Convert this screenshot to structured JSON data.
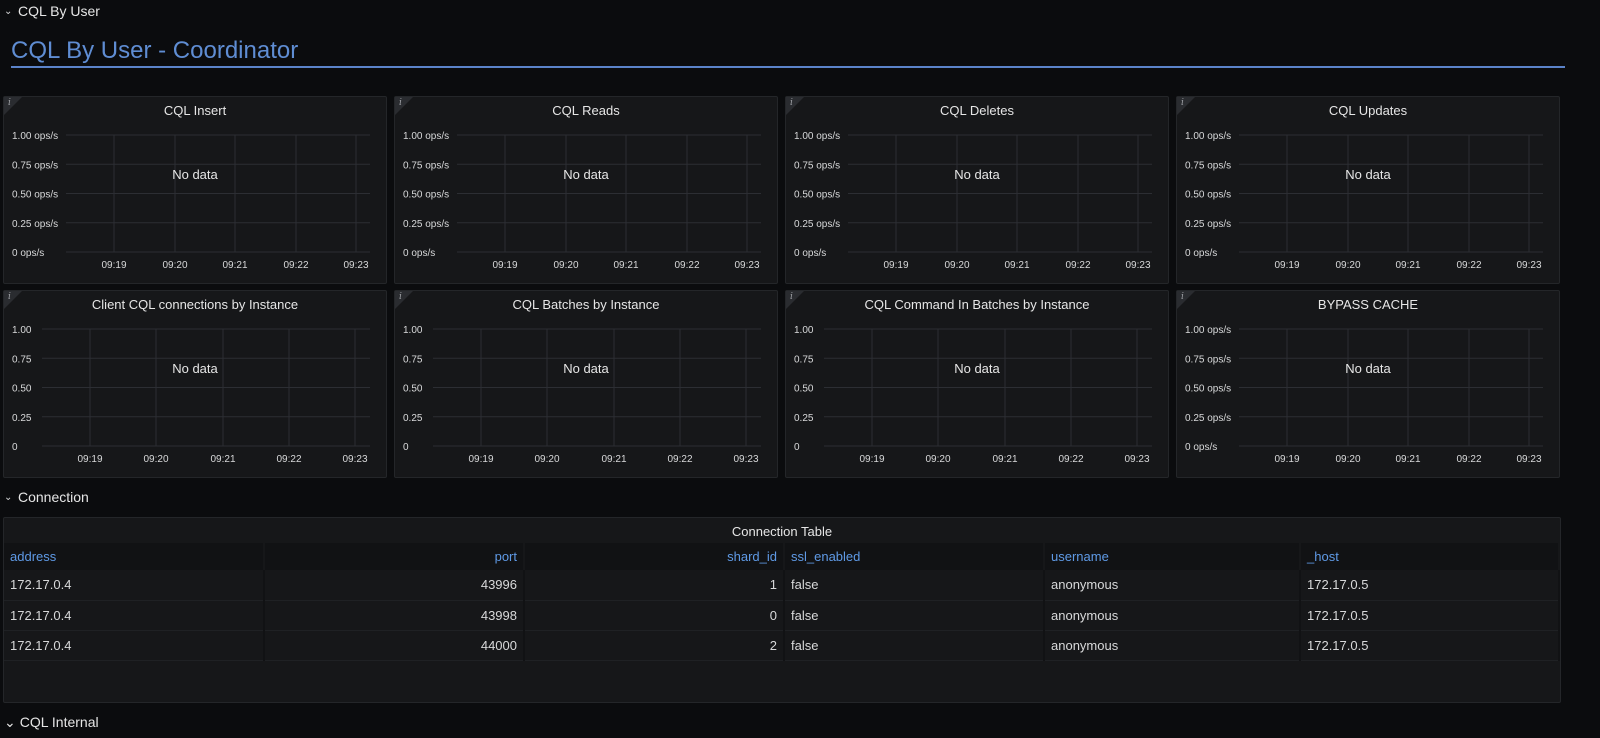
{
  "rows": {
    "cql_by_user": "CQL By User",
    "connection": "Connection",
    "cql_internal": "CQL Internal"
  },
  "section_title": "CQL By User - Coordinator",
  "info_icon": "i",
  "no_data": "No data",
  "x_ticks": [
    "09:19",
    "09:20",
    "09:21",
    "09:22",
    "09:23"
  ],
  "panels": [
    {
      "title": "CQL Insert",
      "y_ticks": [
        "1.00 ops/s",
        "0.75 ops/s",
        "0.50 ops/s",
        "0.25 ops/s",
        "0 ops/s"
      ]
    },
    {
      "title": "CQL Reads",
      "y_ticks": [
        "1.00 ops/s",
        "0.75 ops/s",
        "0.50 ops/s",
        "0.25 ops/s",
        "0 ops/s"
      ]
    },
    {
      "title": "CQL Deletes",
      "y_ticks": [
        "1.00 ops/s",
        "0.75 ops/s",
        "0.50 ops/s",
        "0.25 ops/s",
        "0 ops/s"
      ]
    },
    {
      "title": "CQL Updates",
      "y_ticks": [
        "1.00 ops/s",
        "0.75 ops/s",
        "0.50 ops/s",
        "0.25 ops/s",
        "0 ops/s"
      ]
    },
    {
      "title": "Client CQL connections by Instance",
      "y_ticks": [
        "1.00",
        "0.75",
        "0.50",
        "0.25",
        "0"
      ]
    },
    {
      "title": "CQL Batches by Instance",
      "y_ticks": [
        "1.00",
        "0.75",
        "0.50",
        "0.25",
        "0"
      ]
    },
    {
      "title": "CQL Command In Batches by Instance",
      "y_ticks": [
        "1.00",
        "0.75",
        "0.50",
        "0.25",
        "0"
      ]
    },
    {
      "title": "BYPASS CACHE",
      "y_ticks": [
        "1.00 ops/s",
        "0.75 ops/s",
        "0.50 ops/s",
        "0.25 ops/s",
        "0 ops/s"
      ]
    }
  ],
  "connection_table": {
    "title": "Connection Table",
    "columns": [
      "address",
      "port",
      "shard_id",
      "ssl_enabled",
      "username",
      "_host"
    ],
    "rows": [
      [
        "172.17.0.4",
        "43996",
        "1",
        "false",
        "anonymous",
        "172.17.0.5"
      ],
      [
        "172.17.0.4",
        "43998",
        "0",
        "false",
        "anonymous",
        "172.17.0.5"
      ],
      [
        "172.17.0.4",
        "44000",
        "2",
        "false",
        "anonymous",
        "172.17.0.5"
      ]
    ]
  },
  "colors": {
    "background": "#0b0c0e",
    "panel": "#161719",
    "accent_blue": "#5f8dd3",
    "table_header": "#5f9ae6"
  }
}
